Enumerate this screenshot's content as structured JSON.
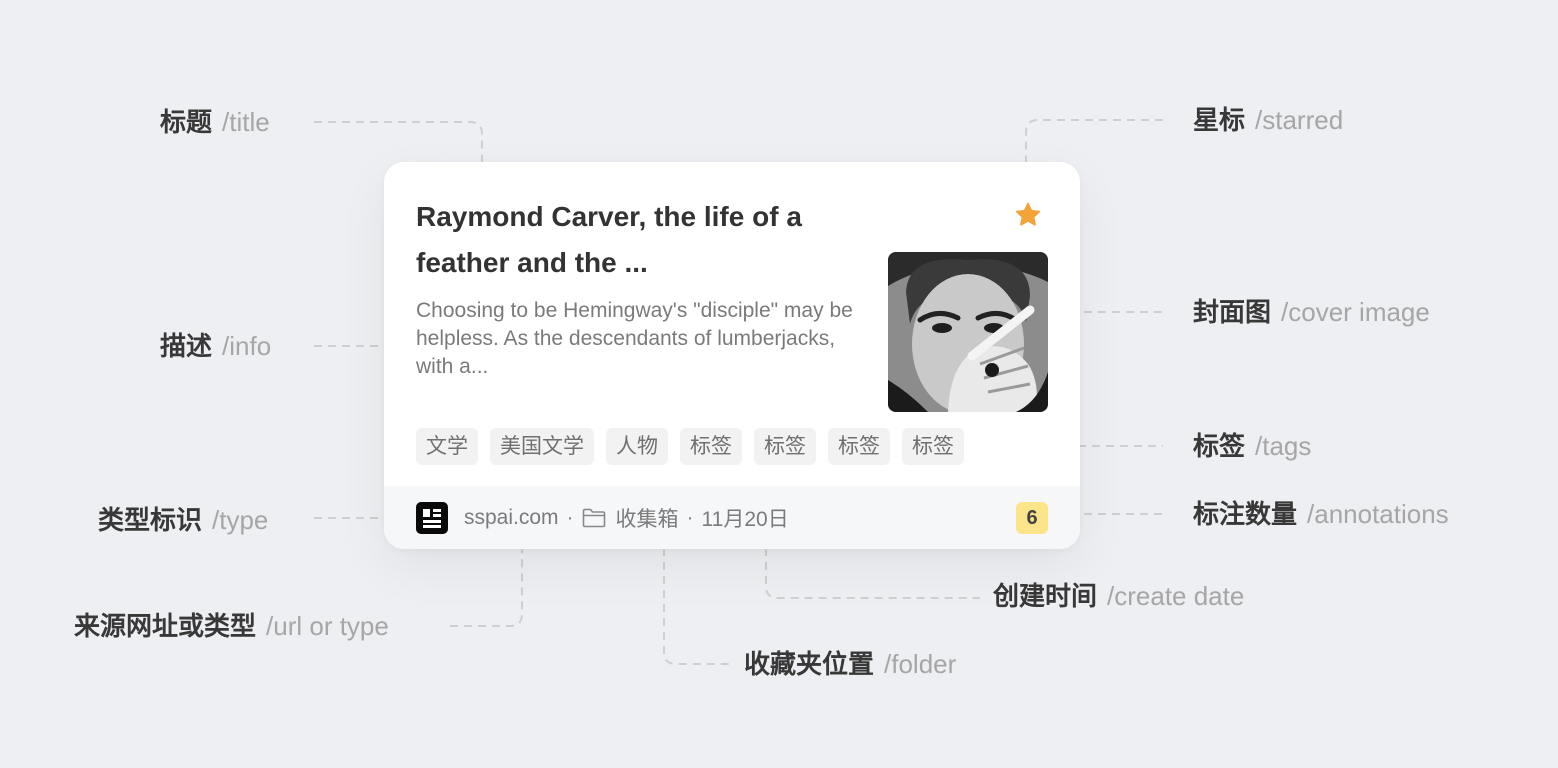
{
  "card": {
    "title": "Raymond Carver, the life of a feather and the ...",
    "description": "Choosing to be Hemingway's \"disciple\" may be helpless. As the descendants of lumberjacks, with a...",
    "tags": [
      "文学",
      "美国文学",
      "人物",
      "标签",
      "标签",
      "标签",
      "标签"
    ],
    "source": "sspai.com",
    "separator": "·",
    "folder": "收集箱",
    "date": "11月20日",
    "annotations_count": "6",
    "starred": true,
    "cover_image": "black-and-white portrait photo"
  },
  "labels": {
    "title": {
      "zh": "标题",
      "en": "/title"
    },
    "starred": {
      "zh": "星标",
      "en": "/starred"
    },
    "info": {
      "zh": "描述",
      "en": "/info"
    },
    "cover": {
      "zh": "封面图",
      "en": "/cover image"
    },
    "tags": {
      "zh": "标签",
      "en": "/tags"
    },
    "type": {
      "zh": "类型标识",
      "en": "/type"
    },
    "annotations": {
      "zh": "标注数量",
      "en": "/annotations"
    },
    "url": {
      "zh": "来源网址或类型",
      "en": "/url or type"
    },
    "create_date": {
      "zh": "创建时间",
      "en": "/create date"
    },
    "folder": {
      "zh": "收藏夹位置",
      "en": "/folder"
    }
  },
  "colors": {
    "background": "#eeeff2",
    "star": "#f3a338",
    "badge": "#fbe48a",
    "leader_line": "#cfcfcf"
  },
  "icons": [
    "star-icon",
    "type-icon",
    "folder-icon"
  ]
}
